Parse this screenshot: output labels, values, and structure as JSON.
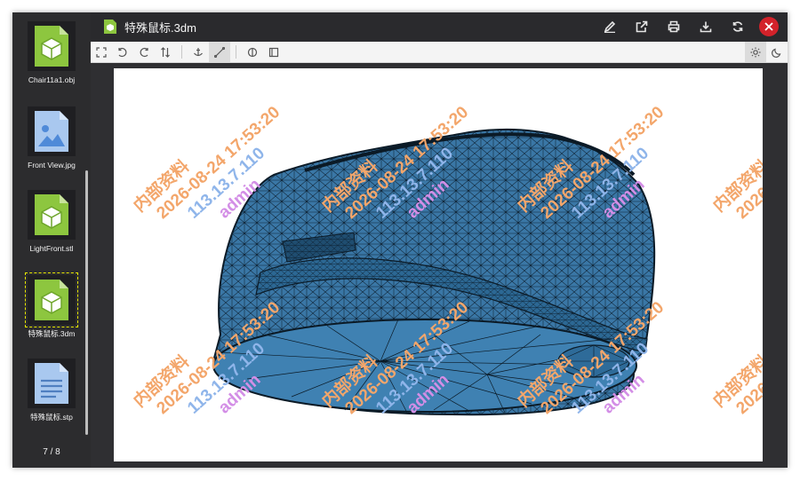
{
  "file_title": "特殊鼠标.3dm",
  "thumbnails": [
    {
      "label": "Chair11a1.obj",
      "icon": "cube-icon"
    },
    {
      "label": "Front View.jpg",
      "icon": "image-icon"
    },
    {
      "label": "LightFront.stl",
      "icon": "cube-icon"
    },
    {
      "label": "特殊鼠标.3dm",
      "icon": "cube-icon",
      "active": true
    },
    {
      "label": "特殊鼠标.stp",
      "icon": "document-icon"
    }
  ],
  "counter": "7 / 8",
  "watermark": {
    "line1": "内部资料",
    "line2": "2026-08-24 17:53:20",
    "line3": "113.13.7.110",
    "line4": "admin"
  },
  "colors": {
    "accent_green": "#8dc63f",
    "close_red": "#d3222a",
    "mesh_blue": "#3b78a8",
    "watermark_orange": "#f3a66b",
    "watermark_blue": "#8fb5ea",
    "watermark_purple": "#d38ee6"
  }
}
